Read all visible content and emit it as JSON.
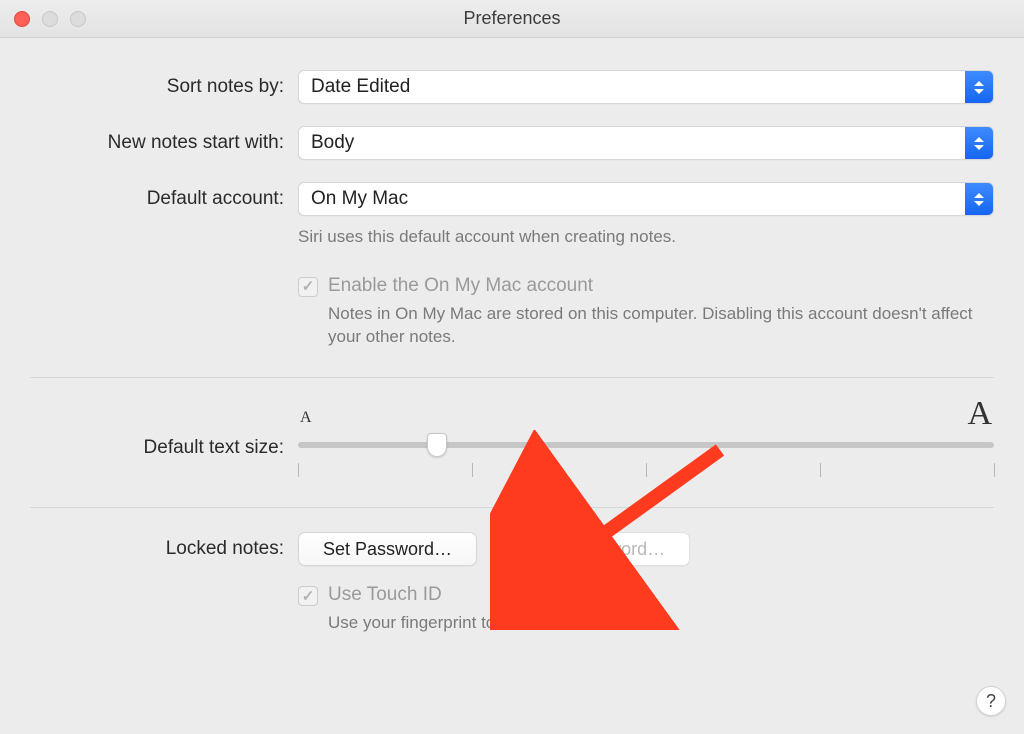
{
  "window": {
    "title": "Preferences"
  },
  "sortNotes": {
    "label": "Sort notes by:",
    "value": "Date Edited"
  },
  "newNotes": {
    "label": "New notes start with:",
    "value": "Body"
  },
  "defaultAccount": {
    "label": "Default account:",
    "value": "On My Mac",
    "hint": "Siri uses this default account when creating notes."
  },
  "enableOnMyMac": {
    "label": "Enable the On My Mac account",
    "hint": "Notes in On My Mac are stored on this computer. Disabling this account doesn't affect your other notes.",
    "checked": true,
    "disabled": true
  },
  "textSize": {
    "label": "Default text size:",
    "smallGlyph": "A",
    "largeGlyph": "A",
    "tickCount": 5,
    "knobPercent": 20
  },
  "lockedNotes": {
    "label": "Locked notes:",
    "setPassword": "Set Password…",
    "resetPassword": "Reset Password…"
  },
  "touchID": {
    "label": "Use Touch ID",
    "hint": "Use your fingerprint to view locked notes.",
    "checked": true,
    "disabled": true
  },
  "help": {
    "label": "?"
  }
}
